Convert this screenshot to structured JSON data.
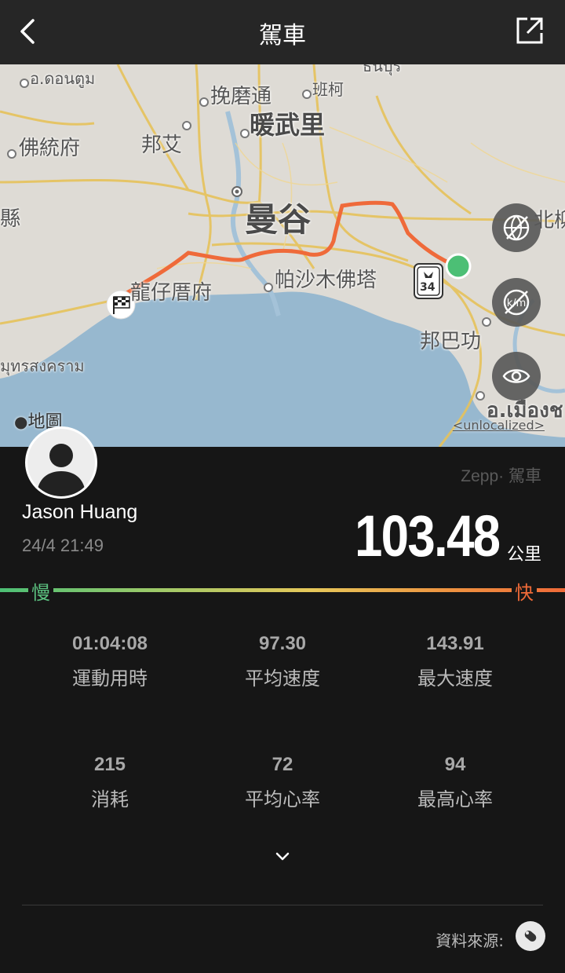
{
  "header": {
    "title": "駕車"
  },
  "map": {
    "labels": {
      "thai_1": "อ.ดอนตูม",
      "thai_top": "ธนบุรี",
      "nonthaburi": "挽磨通",
      "pakkret": "班柯",
      "bangkok_n": "暖武里",
      "nakhon_pathom": "佛統府",
      "banpong": "邦艾",
      "bangkok": "曼谷",
      "ratchaburi": "縣",
      "samut_sakhon": "龍仔厝府",
      "samut_prakan": "帕沙木佛塔",
      "chonburi_n": "北柳",
      "bang_pakong": "邦巴功",
      "samut_songkhram": "มุทรสงคราม",
      "mueang": "อ.เมืองช",
      "route_shield": "34"
    },
    "attribution": "地圖",
    "legal": "<unlocalized>"
  },
  "activity": {
    "user_name": "Jason Huang",
    "datetime": "24/4 21:49",
    "brand": "Zepp· 駕車",
    "distance": "103.48",
    "distance_unit": "公里"
  },
  "speed_legend": {
    "slow": "慢",
    "fast": "快"
  },
  "stats": [
    {
      "value": "01:04:08",
      "label": "運動用時"
    },
    {
      "value": "97.30",
      "label": "平均速度"
    },
    {
      "value": "143.91",
      "label": "最大速度"
    },
    {
      "value": "215",
      "label": "消耗"
    },
    {
      "value": "72",
      "label": "平均心率"
    },
    {
      "value": "94",
      "label": "最高心率"
    }
  ],
  "footer": {
    "source_label": "資料來源:"
  },
  "colors": {
    "route": "#ef6a3a",
    "route_start": "#4cbf75",
    "background": "#161616"
  }
}
